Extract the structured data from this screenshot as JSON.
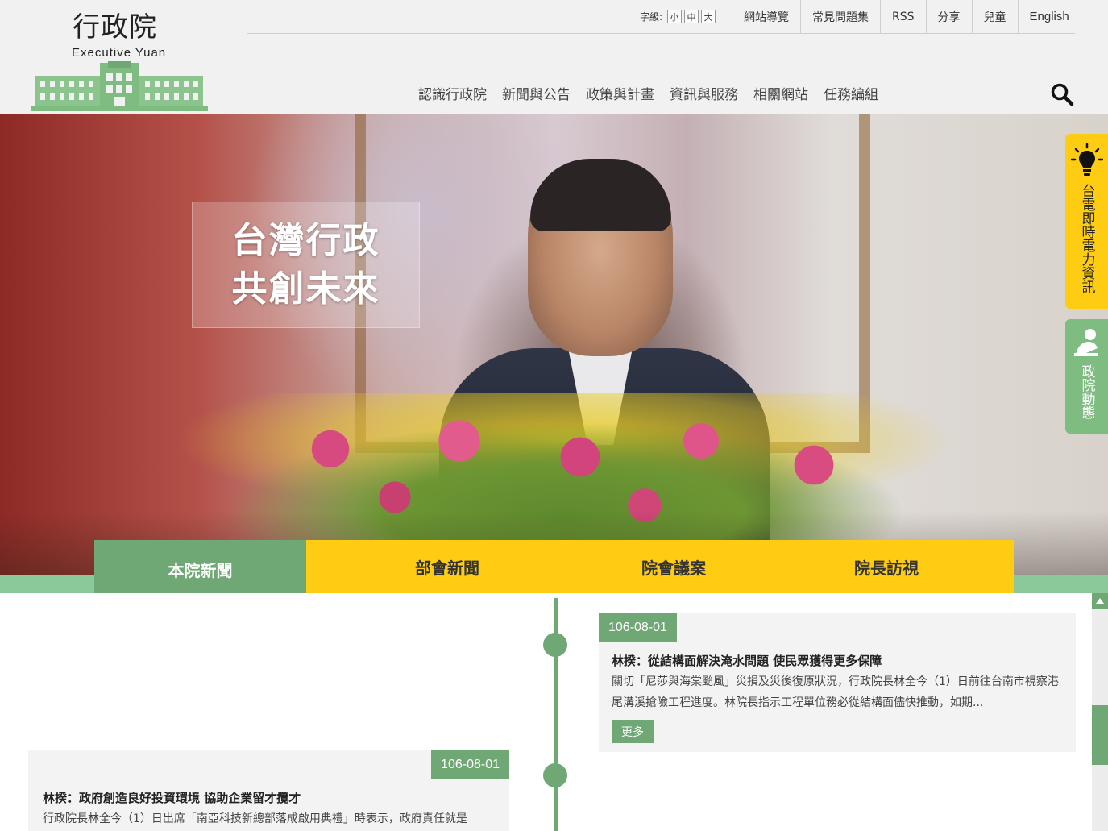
{
  "site": {
    "logo_cn": "行政院",
    "logo_en": "Executive Yuan"
  },
  "fontsize": {
    "label": "字級:",
    "options": [
      "小",
      "中",
      "大"
    ]
  },
  "toplinks": [
    "網站導覽",
    "常見問題集",
    "RSS",
    "分享",
    "兒童",
    "English"
  ],
  "mainnav": [
    "認識行政院",
    "新聞與公告",
    "政策與計畫",
    "資訊與服務",
    "相關網站",
    "任務編組"
  ],
  "hero": {
    "slogan_line1": "台灣行政",
    "slogan_line2": "共創未來"
  },
  "tabs": [
    "本院新聞",
    "部會新聞",
    "院會議案",
    "院長訪視"
  ],
  "news": [
    {
      "date": "106-08-01",
      "title": "林揆：從結構面解決淹水問題 使民眾獲得更多保障",
      "excerpt": "關切「尼莎與海棠颱風」災損及災後復原狀況，行政院長林全今（1）日前往台南市視察港尾溝溪搶險工程進度。林院長指示工程單位務必從結構面儘快推動，如期...",
      "more": "更多"
    },
    {
      "date": "106-08-01",
      "title": "林揆：政府創造良好投資環境 協助企業留才攬才",
      "excerpt": "行政院長林全今（1）日出席「南亞科技新總部落成啟用典禮」時表示，政府責任就是"
    }
  ],
  "side": {
    "power_label": "台電即時電力資訊",
    "dynamics_label": "政院動態"
  },
  "colors": {
    "green": "#6fa874",
    "yellow": "#fdcc13",
    "header_bg": "#f1f1f1"
  }
}
